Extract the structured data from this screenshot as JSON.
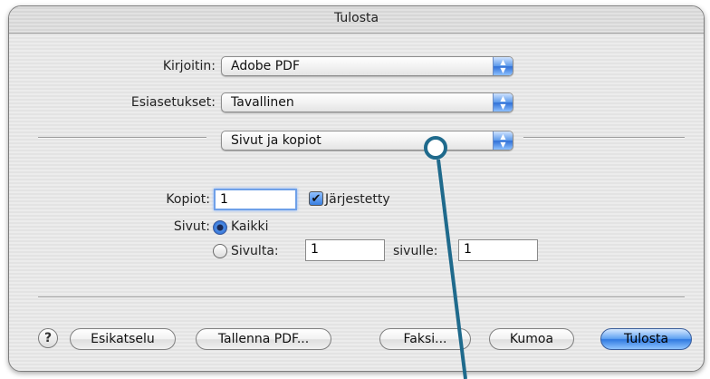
{
  "window": {
    "title": "Tulosta"
  },
  "printer": {
    "label": "Kirjoitin:",
    "value": "Adobe PDF"
  },
  "presets": {
    "label": "Esiasetukset:",
    "value": "Tavallinen"
  },
  "panel_menu": {
    "value": "Sivut ja kopiot"
  },
  "copies": {
    "label": "Kopiot:",
    "value": "1",
    "collated_label": "Järjestetty",
    "collated_checked": true
  },
  "pages": {
    "label": "Sivut:",
    "all_label": "Kaikki",
    "from_label": "Sivulta:",
    "from_value": "1",
    "to_label": "sivulle:",
    "to_value": "1"
  },
  "buttons": {
    "help": "?",
    "preview": "Esikatselu",
    "save_pdf": "Tallenna PDF...",
    "fax": "Faksi...",
    "cancel": "Kumoa",
    "print": "Tulosta"
  },
  "colors": {
    "accent": "#3a7fe0",
    "callout": "#1f6a8c"
  }
}
